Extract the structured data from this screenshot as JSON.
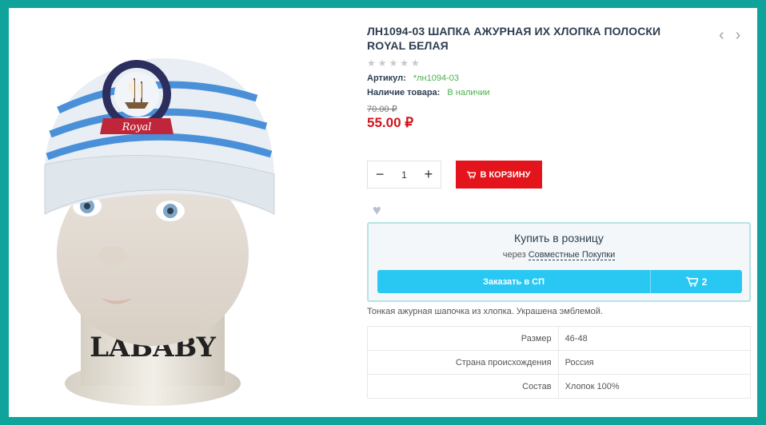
{
  "product": {
    "title": "ЛН1094-03 ШАПКА АЖУРНАЯ ИХ ХЛОПКА ПОЛОСКИ ROYAL БЕЛАЯ",
    "stars": "★★★★★",
    "article_label": "Артикул:",
    "article_value": "*лн1094-03",
    "availability_label": "Наличие товара:",
    "availability_value": "В наличии",
    "old_price": "70.00 ₽",
    "price": "55.00 ₽",
    "description": "Тонкая ажурная шапочка из хлопка. Украшена эмблемой.",
    "image": {
      "emblem_text": "Royal",
      "stand_text": "LABABY"
    }
  },
  "navigation": {
    "prev_icon": "‹",
    "next_icon": "›"
  },
  "cart": {
    "minus": "−",
    "quantity": "1",
    "plus": "+",
    "add_to_cart_label": "В КОРЗИНУ"
  },
  "retail": {
    "title": "Купить в розницу",
    "via_text": "через",
    "via_link": "Совместные Покупки",
    "order_button": "Заказать в СП",
    "cart_count": "2"
  },
  "specs": [
    {
      "key": "Размер",
      "value": "46-48"
    },
    {
      "key": "Страна происхождения",
      "value": "Россия"
    },
    {
      "key": "Состав",
      "value": "Хлопок 100%"
    }
  ],
  "colors": {
    "border": "#10a39b",
    "accent_red": "#e3141b",
    "price_red": "#d0141d",
    "sp_blue": "#29c8f3",
    "in_stock_green": "#4caf50"
  }
}
